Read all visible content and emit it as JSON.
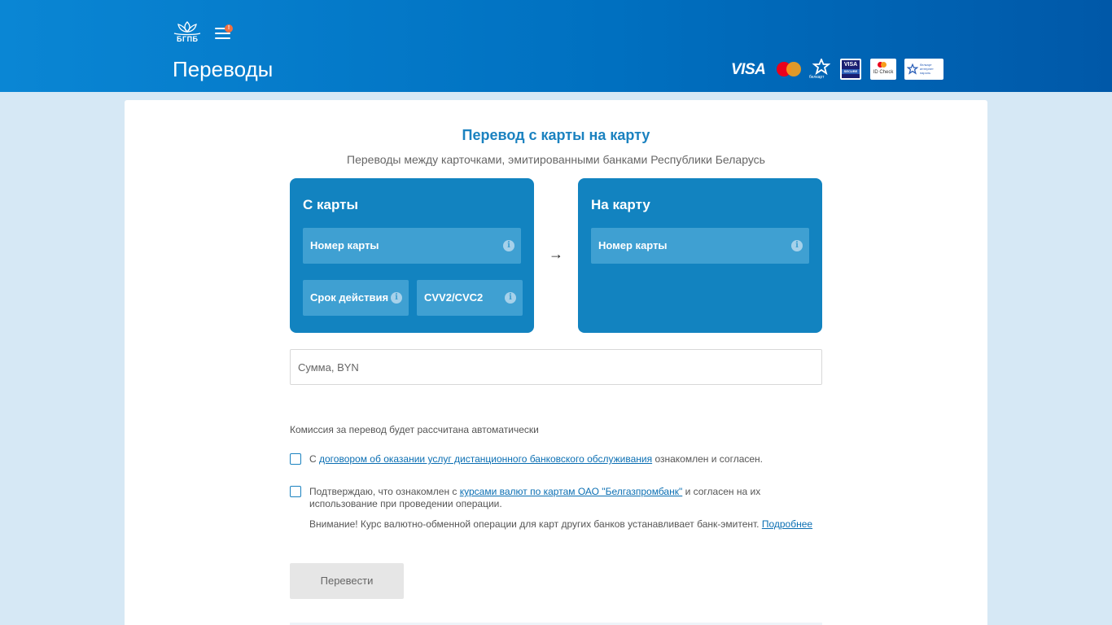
{
  "header": {
    "logo_text": "БГПБ",
    "menu_badge": "!",
    "title": "Переводы",
    "payment_logos": {
      "visa": "VISA",
      "mastercard": "mastercard-logo",
      "belkart_label": "белкарт",
      "visa_secure_top": "VISA",
      "visa_secure_bottom": "SECURE",
      "id_check": "ID Check",
      "belinet": "белкарт интернет пароль"
    }
  },
  "form": {
    "title": "Перевод с карты на карту",
    "subtitle": "Переводы между карточками, эмитированными банками Республики Беларусь",
    "from_card": {
      "title": "С карты",
      "card_number": "Номер карты",
      "expiry": "Срок действия",
      "cvv": "CVV2/CVC2"
    },
    "arrow": "→",
    "to_card": {
      "title": "На карту",
      "card_number": "Номер карты"
    },
    "amount_placeholder": "Сумма, BYN",
    "commission": "Комиссия за перевод будет рассчитана автоматически",
    "agreement": {
      "prefix": "С ",
      "link": "договором об оказании услуг дистанционного банковского обслуживания",
      "suffix": " ознакомлен и согласен."
    },
    "rates": {
      "prefix": "Подтверждаю, что ознакомлен с ",
      "link": "курсами валют по картам ОАО \"Белгазпромбанк\"",
      "suffix": " и согласен на их использование при проведении операции.",
      "warning": "Внимание! Курс валютно-обменной операции для карт других банков устанавливает банк-эмитент. ",
      "warning_link": "Подробнее"
    },
    "submit": "Перевести"
  },
  "colors": {
    "header_gradient_start": "#0a86d4",
    "header_gradient_end": "#0058a8",
    "card_blue": "#1283c0",
    "field_blue": "#3fa0d2",
    "accent": "#1b82c0"
  }
}
